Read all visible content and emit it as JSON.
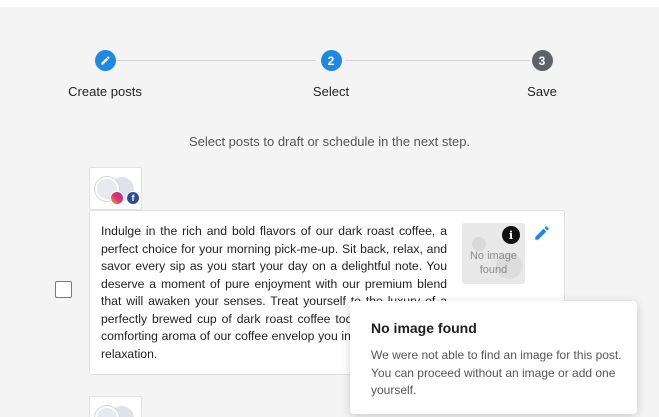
{
  "stepper": {
    "steps": [
      {
        "label": "Create posts",
        "state": "complete",
        "icon": "pencil-icon"
      },
      {
        "label": "Select",
        "state": "active",
        "number": "2"
      },
      {
        "label": "Save",
        "state": "pending",
        "number": "3"
      }
    ]
  },
  "subtitle": "Select posts to draft or schedule in the next step.",
  "colors": {
    "accent": "#1e88e5",
    "pending": "#5f6368"
  },
  "post": {
    "channels": [
      "instagram-icon",
      "facebook-icon"
    ],
    "facebook_glyph": "f",
    "text": "Indulge in the rich and bold flavors of our dark roast coffee, a perfect choice for your morning pick-me-up. Sit back, relax, and savor every sip as you start your day on a delightful note. You deserve a moment of pure enjoyment with our premium blend that will awaken your senses. Treat yourself to the luxury of a perfectly brewed cup of dark roast coffee today. Let the deep, comforting aroma of our coffee envelop you in a cozy blanket of relaxation.",
    "image_placeholder": "No image found",
    "info_glyph": "i"
  },
  "tooltip": {
    "title": "No image found",
    "body": "We were not able to find an image for this post. You can proceed without an image or add one yourself."
  }
}
